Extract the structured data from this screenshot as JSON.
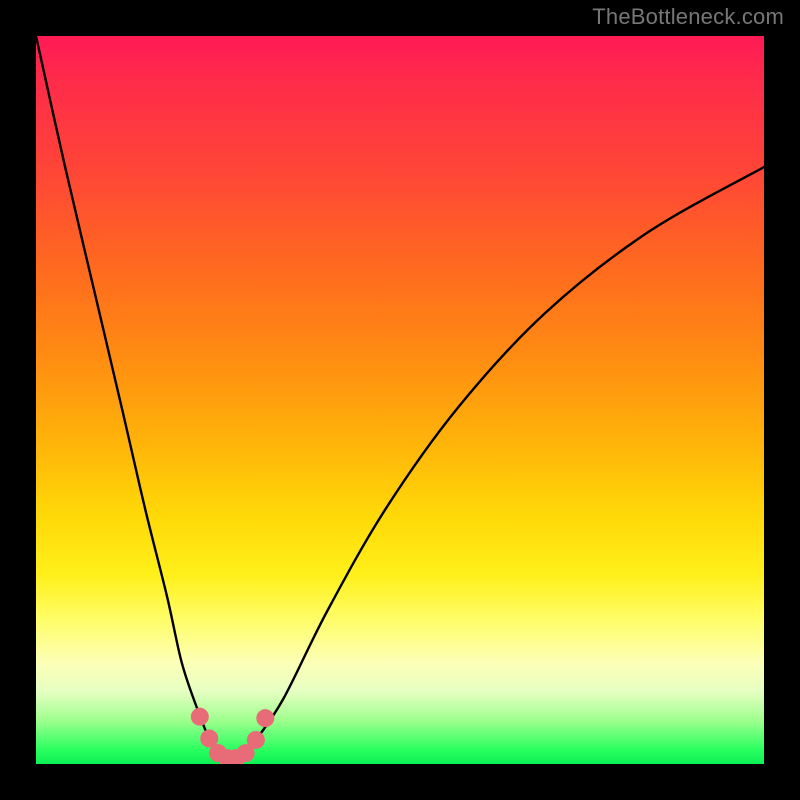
{
  "watermark": "TheBottleneck.com",
  "chart_data": {
    "type": "line",
    "title": "",
    "xlabel": "",
    "ylabel": "",
    "xlim": [
      0,
      100
    ],
    "ylim": [
      0,
      100
    ],
    "series": [
      {
        "name": "bottleneck-curve",
        "x": [
          0,
          4,
          8,
          12,
          15,
          18,
          20,
          22,
          24,
          25.5,
          27,
          28.5,
          30,
          34,
          40,
          48,
          58,
          70,
          84,
          100
        ],
        "values": [
          100,
          82,
          65,
          48,
          35,
          23,
          14,
          8,
          3,
          1,
          0,
          1,
          3,
          9,
          21,
          35,
          49,
          62,
          73,
          82
        ]
      }
    ],
    "markers": {
      "name": "trough-markers",
      "color": "#e86b78",
      "radius_px": 9,
      "x": [
        22.5,
        23.8,
        25.0,
        26.3,
        27.5,
        28.8,
        30.2,
        31.5
      ],
      "values": [
        6.5,
        3.5,
        1.5,
        0.8,
        0.8,
        1.5,
        3.3,
        6.3
      ]
    }
  }
}
